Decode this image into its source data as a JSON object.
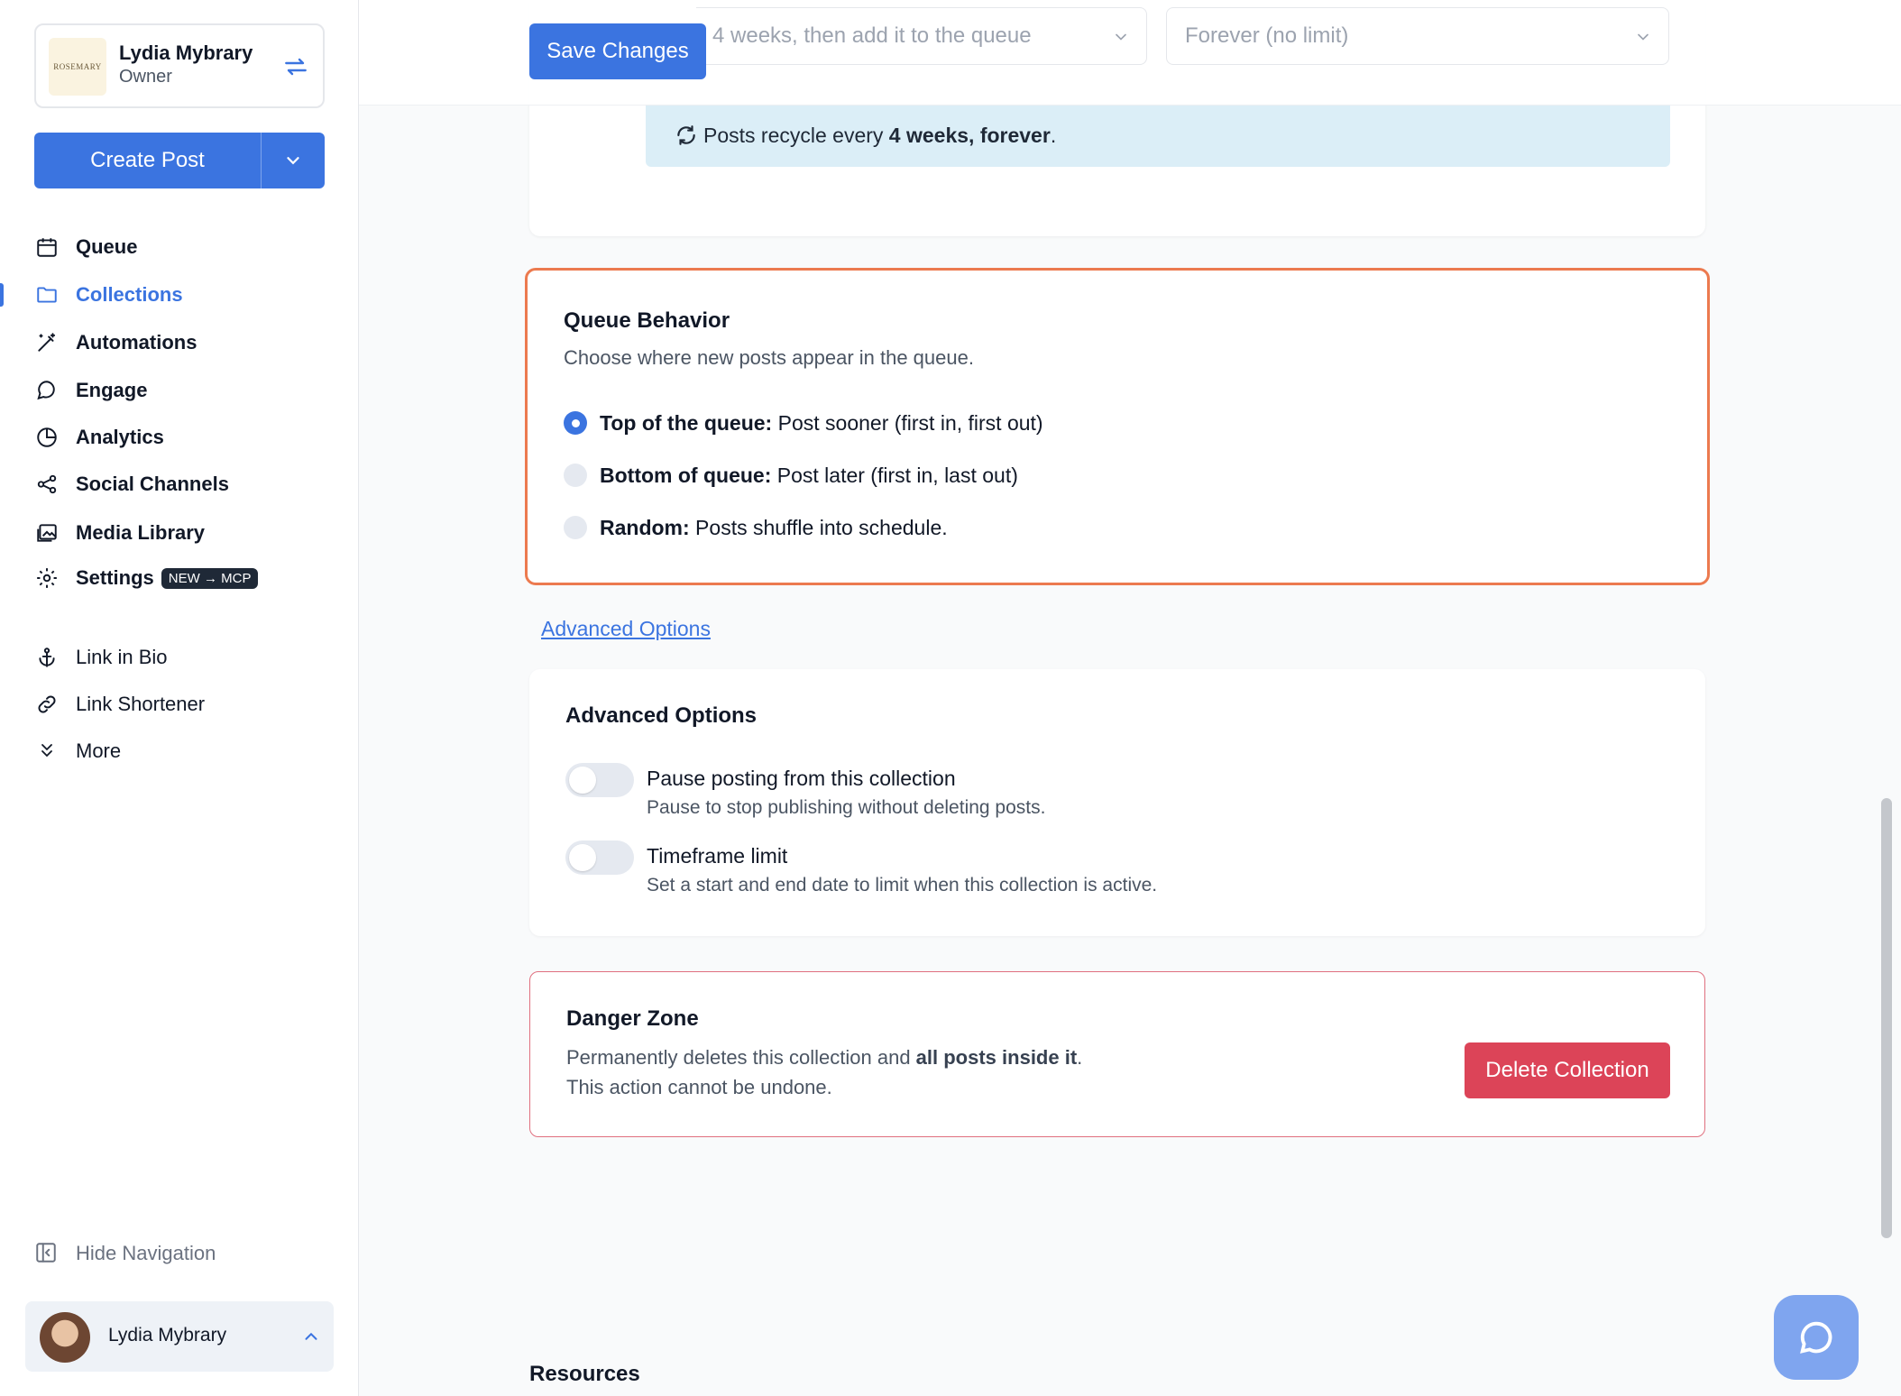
{
  "colors": {
    "primary": "#3b74e0",
    "danger": "#dc4458",
    "highlight_border": "#ec7a4f",
    "banner_bg": "#dbeef7"
  },
  "account": {
    "logo_text": "ROSEMARY",
    "name": "Lydia Mybrary",
    "role": "Owner",
    "switch_icon": "switch-arrows-icon"
  },
  "create_post": {
    "label": "Create Post"
  },
  "nav": {
    "queue": "Queue",
    "collections": "Collections",
    "automations": "Automations",
    "engage": "Engage",
    "analytics": "Analytics",
    "social_channels": "Social Channels",
    "media_library": "Media Library",
    "settings": "Settings",
    "settings_badge": "NEW → MCP",
    "link_in_bio": "Link in Bio",
    "link_shortener": "Link Shortener",
    "more": "More"
  },
  "hide_navigation": "Hide Navigation",
  "user": {
    "name": "Lydia Mybrary"
  },
  "toolbar": {
    "save_label": "Save Changes"
  },
  "recycle": {
    "wait_value": "4 weeks, then add it to the queue",
    "limit_value": "Forever (no limit)",
    "banner_prefix": "Posts recycle every ",
    "banner_bold": "4 weeks, forever",
    "banner_suffix": "."
  },
  "queue_behavior": {
    "title": "Queue Behavior",
    "subtitle": "Choose where new posts appear in the queue.",
    "options": [
      {
        "label": "Top of the queue:",
        "desc": " Post sooner (first in, first out)",
        "selected": true
      },
      {
        "label": "Bottom of queue:",
        "desc": " Post later (first in, last out)",
        "selected": false
      },
      {
        "label": "Random:",
        "desc": " Posts shuffle into schedule.",
        "selected": false
      }
    ]
  },
  "advanced_link": "Advanced Options",
  "advanced": {
    "title": "Advanced Options",
    "options": [
      {
        "title": "Pause posting from this collection",
        "desc": "Pause to stop publishing without deleting posts.",
        "on": false
      },
      {
        "title": "Timeframe limit",
        "desc": "Set a start and end date to limit when this collection is active.",
        "on": false
      }
    ]
  },
  "danger": {
    "title": "Danger Zone",
    "desc_prefix": "Permanently deletes this collection and ",
    "desc_bold": "all posts inside it",
    "desc_suffix": ".",
    "desc_line2": "This action cannot be undone.",
    "button": "Delete Collection"
  },
  "resources_title": "Resources"
}
